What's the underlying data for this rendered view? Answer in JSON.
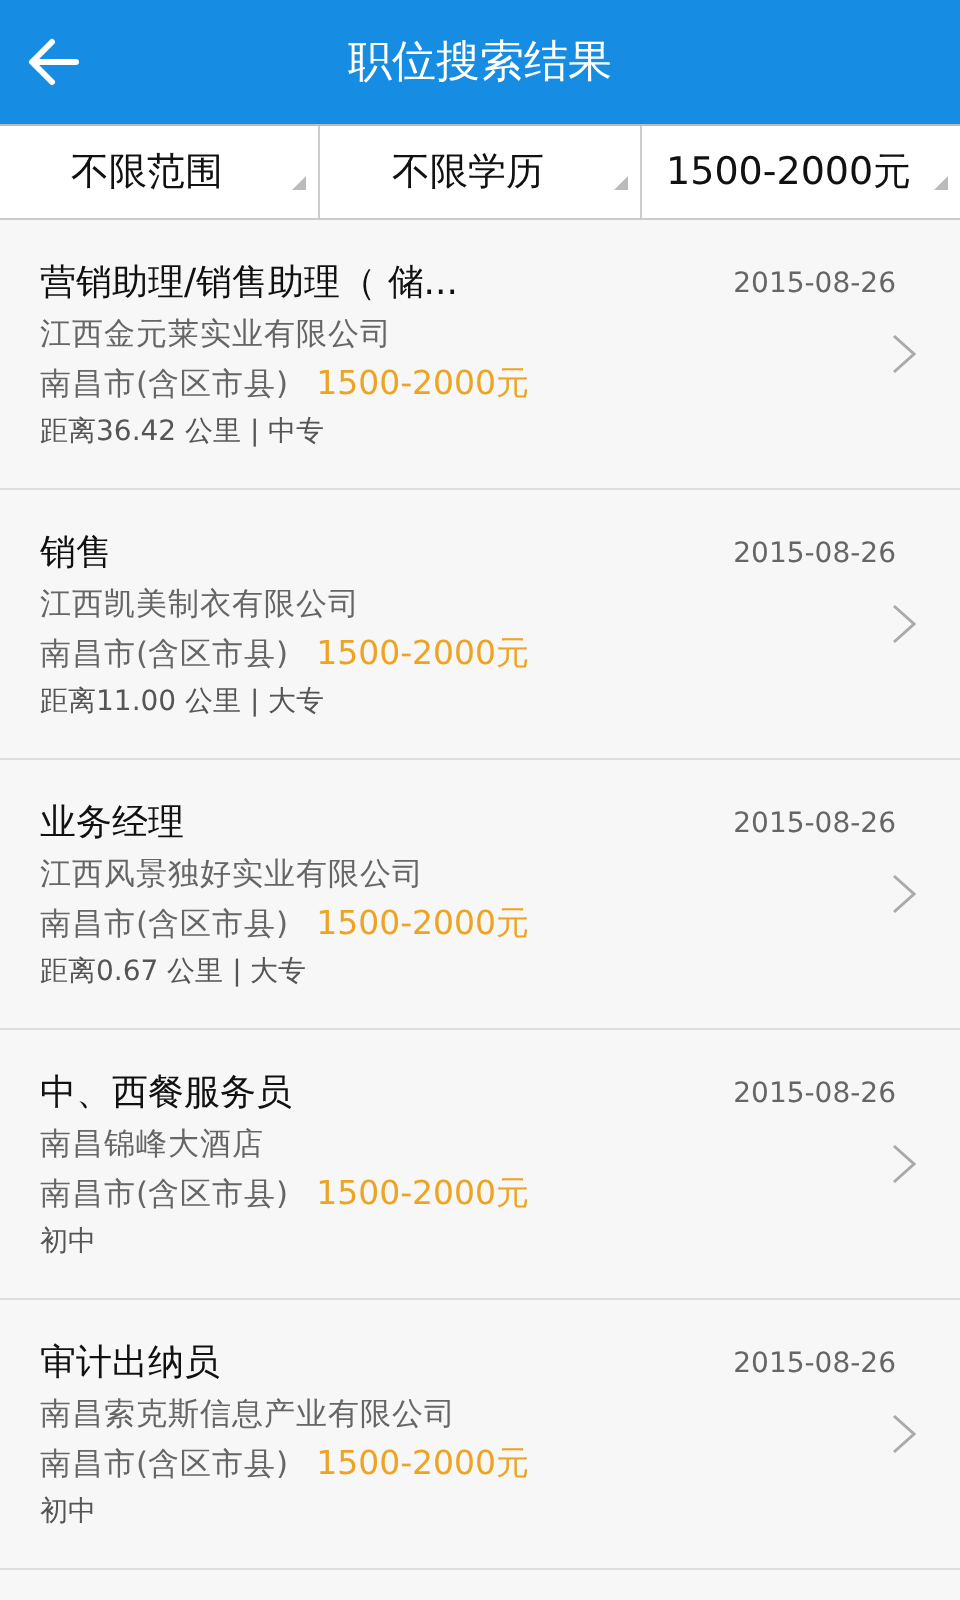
{
  "header": {
    "title": "职位搜索结果"
  },
  "filters": [
    {
      "label": "不限范围"
    },
    {
      "label": "不限学历"
    },
    {
      "label": "1500-2000元"
    }
  ],
  "jobs": [
    {
      "title": "营销助理/销售助理（ 储...",
      "date": "2015-08-26",
      "company": "江西金元莱实业有限公司",
      "location": "南昌市(含区市县)",
      "salary": "1500-2000元",
      "detail": "距离36.42 公里 | 中专"
    },
    {
      "title": "销售",
      "date": "2015-08-26",
      "company": "江西凯美制衣有限公司",
      "location": "南昌市(含区市县)",
      "salary": "1500-2000元",
      "detail": "距离11.00 公里 | 大专"
    },
    {
      "title": "业务经理",
      "date": "2015-08-26",
      "company": "江西风景独好实业有限公司",
      "location": "南昌市(含区市县)",
      "salary": "1500-2000元",
      "detail": "距离0.67 公里 | 大专"
    },
    {
      "title": "中、西餐服务员",
      "date": "2015-08-26",
      "company": "南昌锦峰大酒店",
      "location": "南昌市(含区市县)",
      "salary": "1500-2000元",
      "detail": "初中"
    },
    {
      "title": "审计出纳员",
      "date": "2015-08-26",
      "company": "南昌索克斯信息产业有限公司",
      "location": "南昌市(含区市县)",
      "salary": "1500-2000元",
      "detail": "初中"
    }
  ]
}
